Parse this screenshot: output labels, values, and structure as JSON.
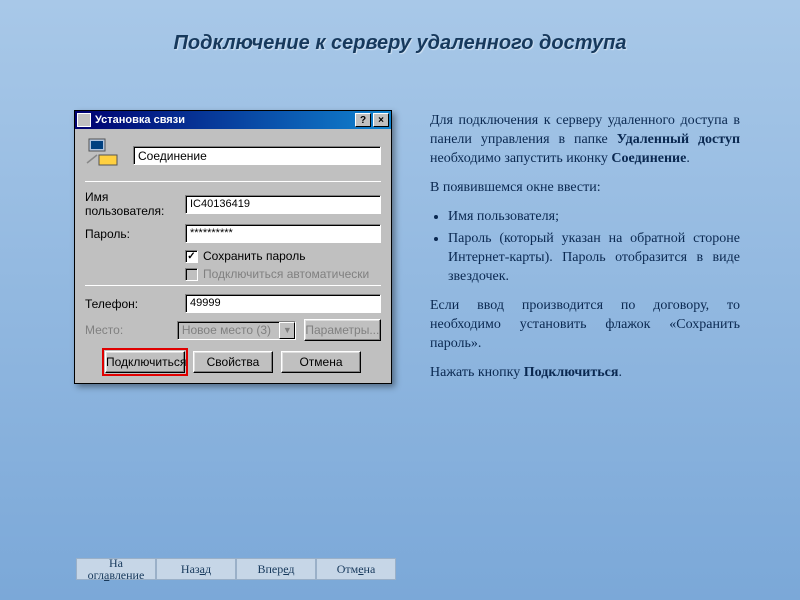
{
  "page_title": "Подключение к серверу удаленного доступа",
  "dialog": {
    "title": "Установка связи",
    "help_btn": "?",
    "close_btn": "×",
    "connection_name": "Соединение",
    "labels": {
      "username": "Имя пользователя:",
      "password": "Пароль:",
      "phone": "Телефон:",
      "place": "Место:"
    },
    "values": {
      "username": "IC40136419",
      "password": "**********",
      "phone": "49999",
      "place": "Новое место (3)"
    },
    "checks": {
      "save_password": "Сохранить пароль",
      "save_password_checked": "✓",
      "auto_connect": "Подключиться автоматически"
    },
    "buttons": {
      "connect": "Подключиться",
      "properties": "Свойства",
      "cancel": "Отмена",
      "params": "Параметры..."
    }
  },
  "instructions": {
    "p1a": "Для подключения к серверу удаленного доступа в панели управления в папке ",
    "p1b": "Удаленный доступ",
    "p1c": " необходимо запустить иконку ",
    "p1d": "Соединение",
    "p1e": ".",
    "p2": "В появившемся окне ввести:",
    "li1": "Имя пользователя;",
    "li2": "Пароль (который указан на обратной стороне Интернет-карты). Пароль отобразится в виде звездочек.",
    "p3": "Если ввод производится по договору, то необходимо установить флажок «Сохранить пароль».",
    "p4a": "Нажать кнопку ",
    "p4b": "Подключиться",
    "p4c": "."
  },
  "nav": {
    "toc": "На оглавление",
    "back": "Назад",
    "forward": "Вперед",
    "cancel": "Отмена"
  }
}
